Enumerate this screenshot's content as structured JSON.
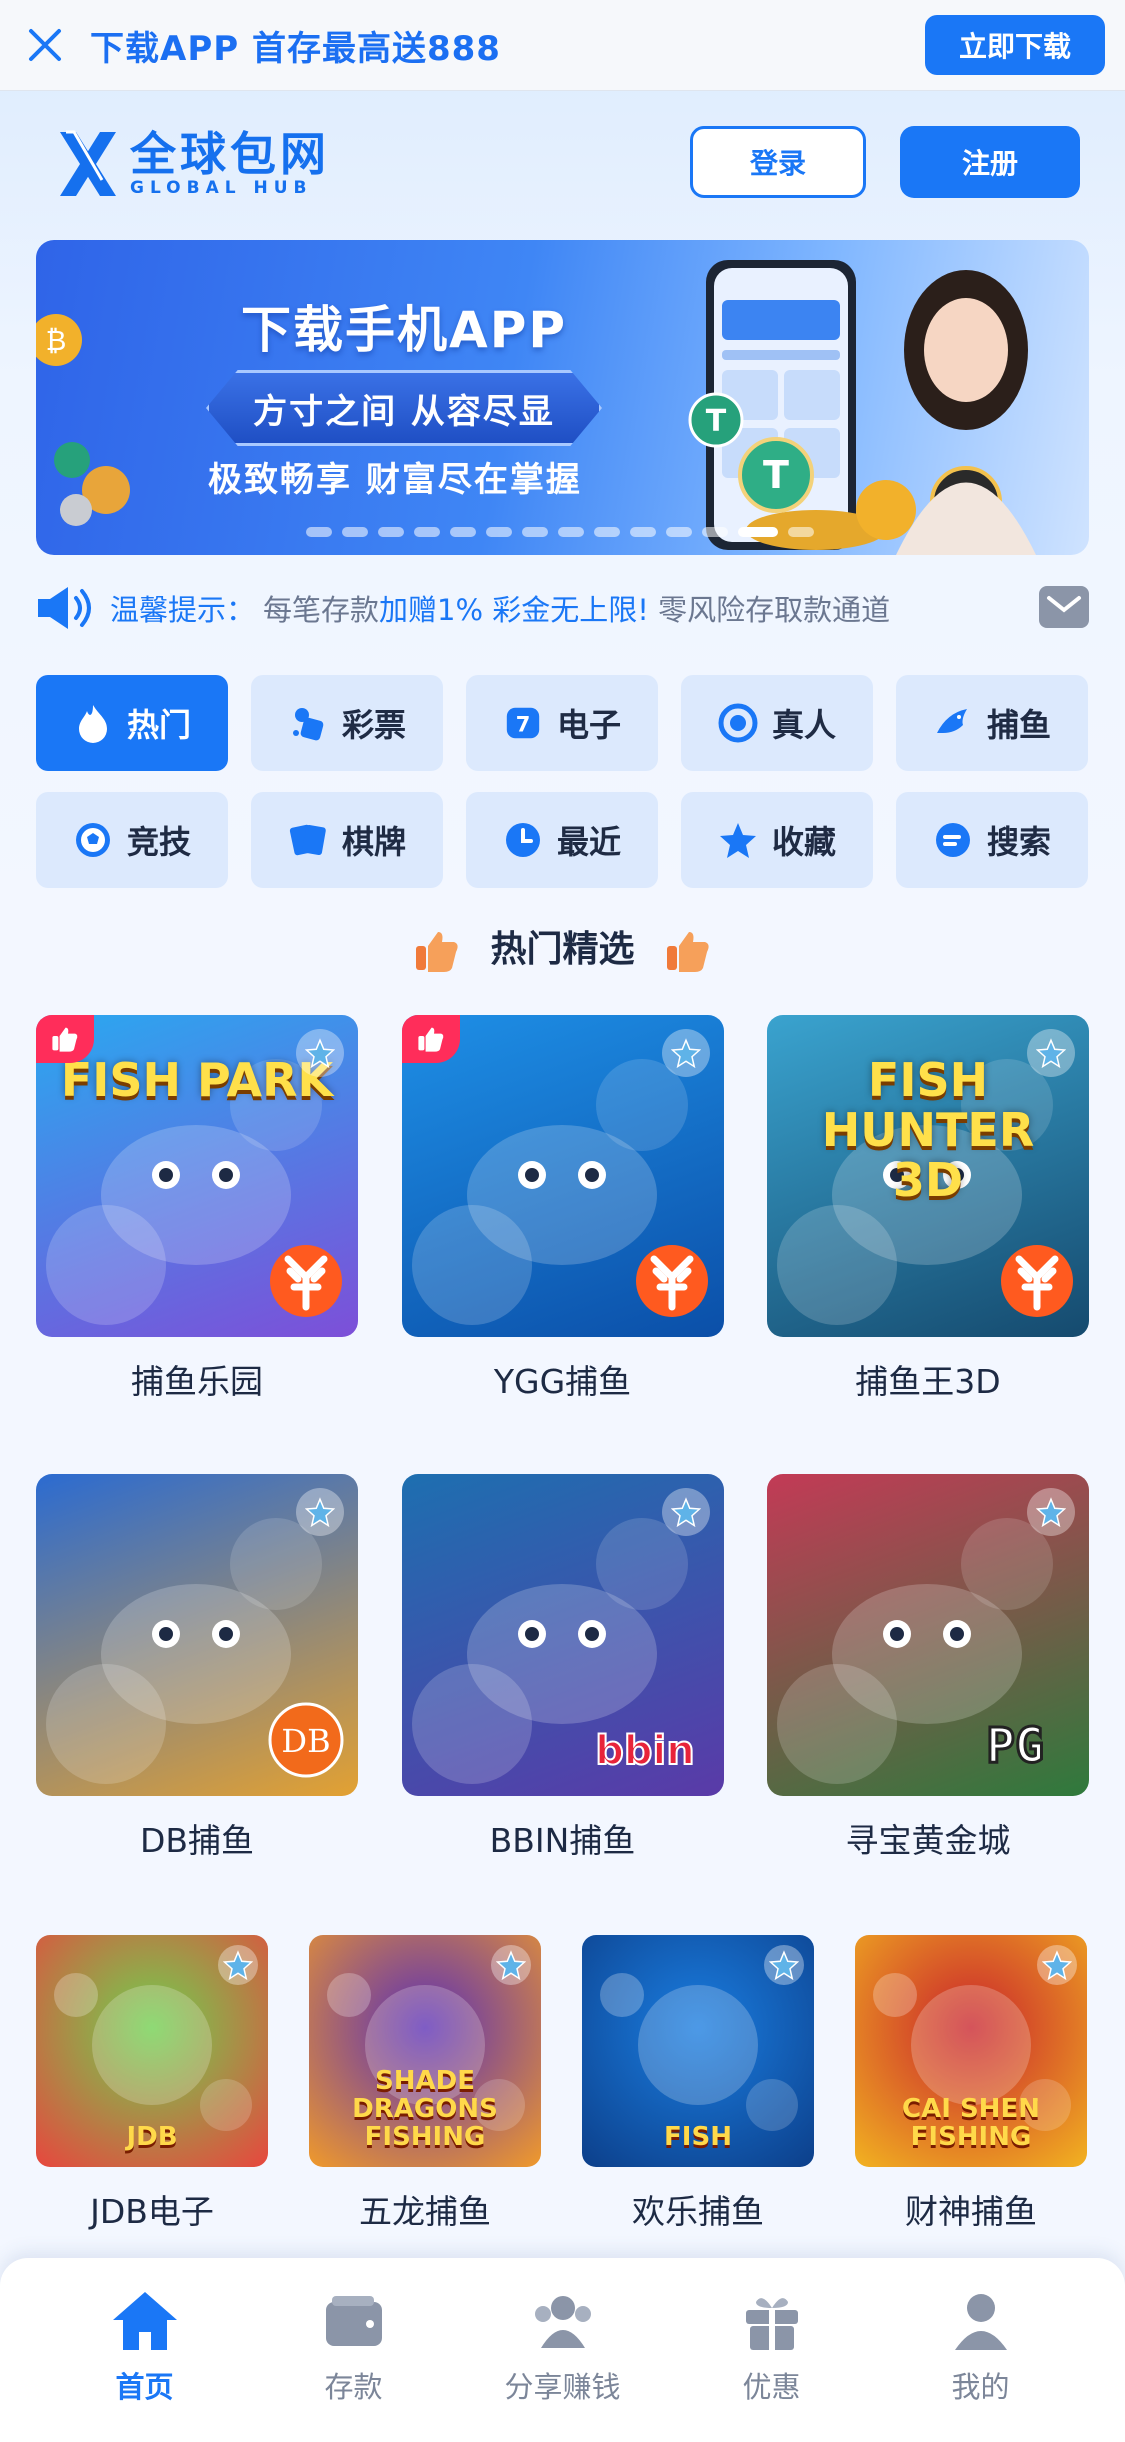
{
  "topbar": {
    "promo": "下载APP 首存最高送888",
    "download_button": "立即下载"
  },
  "header": {
    "logo_cn": "全球包网",
    "logo_en": "GLOBAL HUB",
    "login_button": "登录",
    "register_button": "注册"
  },
  "banner": {
    "title": "下载手机APP",
    "pill": "方寸之间 从容尽显",
    "subtitle": "极致畅享 财富尽在掌握",
    "slide_count": 14,
    "active_slide": 12
  },
  "notice": {
    "label": "温馨提示：",
    "message_pre": "每笔存款",
    "message_hl": "加赠1% 彩金无上限!",
    "message_post": " 零风险存取款通道"
  },
  "categories": [
    {
      "label": "热门",
      "icon": "fire-icon",
      "active": true
    },
    {
      "label": "彩票",
      "icon": "lottery-icon",
      "active": false
    },
    {
      "label": "电子",
      "icon": "slot-icon",
      "active": false
    },
    {
      "label": "真人",
      "icon": "live-icon",
      "active": false
    },
    {
      "label": "捕鱼",
      "icon": "fish-icon",
      "active": false
    },
    {
      "label": "竞技",
      "icon": "soccer-ball-icon",
      "active": false
    },
    {
      "label": "棋牌",
      "icon": "cards-icon",
      "active": false
    },
    {
      "label": "最近",
      "icon": "clock-icon",
      "active": false
    },
    {
      "label": "收藏",
      "icon": "star-icon",
      "active": false
    },
    {
      "label": "搜索",
      "icon": "search-icon",
      "active": false
    }
  ],
  "section_title": "热门精选",
  "games": [
    {
      "name": "捕鱼乐园",
      "art_text": "FISH PARK",
      "provider": "YGG",
      "hot": true,
      "colors": [
        "#2aa8f0",
        "#7d4fd8"
      ]
    },
    {
      "name": "YGG捕鱼",
      "art_text": "",
      "provider": "YGG",
      "hot": true,
      "colors": [
        "#1e8fe6",
        "#0b4fa8"
      ]
    },
    {
      "name": "捕鱼王3D",
      "art_text": "FISH HUNTER 3D",
      "provider": "YGG",
      "hot": false,
      "colors": [
        "#3aa3cf",
        "#154a6e"
      ]
    },
    {
      "name": "DB捕鱼",
      "art_text": "",
      "provider": "DB",
      "hot": false,
      "colors": [
        "#2b6bd1",
        "#e3a132"
      ]
    },
    {
      "name": "BBIN捕鱼",
      "art_text": "",
      "provider": "bbin",
      "hot": false,
      "colors": [
        "#1d6fb0",
        "#5a3aa8"
      ]
    },
    {
      "name": "寻宝黄金城",
      "art_text": "",
      "provider": "PG",
      "hot": false,
      "colors": [
        "#c33a56",
        "#2e7a3c"
      ]
    }
  ],
  "games_row": [
    {
      "name": "JDB电子",
      "art_text": "JDB",
      "colors": [
        "#6fd04f",
        "#e8463e"
      ]
    },
    {
      "name": "五龙捕鱼",
      "art_text": "SHADE DRAGONS FISHING",
      "colors": [
        "#5b2fb5",
        "#f09a2b"
      ]
    },
    {
      "name": "欢乐捕鱼",
      "art_text": "FISH",
      "colors": [
        "#1a7de0",
        "#0c3f8a"
      ]
    },
    {
      "name": "财神捕鱼",
      "art_text": "CAI SHEN FISHING",
      "colors": [
        "#c9242c",
        "#f2b321"
      ]
    }
  ],
  "tabbar": [
    {
      "label": "首页",
      "icon": "home-icon",
      "active": true
    },
    {
      "label": "存款",
      "icon": "wallet-icon",
      "active": false
    },
    {
      "label": "分享赚钱",
      "icon": "share-users-icon",
      "active": false
    },
    {
      "label": "优惠",
      "icon": "gift-icon",
      "active": false
    },
    {
      "label": "我的",
      "icon": "profile-icon",
      "active": false
    }
  ],
  "colors": {
    "primary": "#1a77f6",
    "hot_badge": "#ff2d5a",
    "provider_badge": "#ff5a1f"
  }
}
